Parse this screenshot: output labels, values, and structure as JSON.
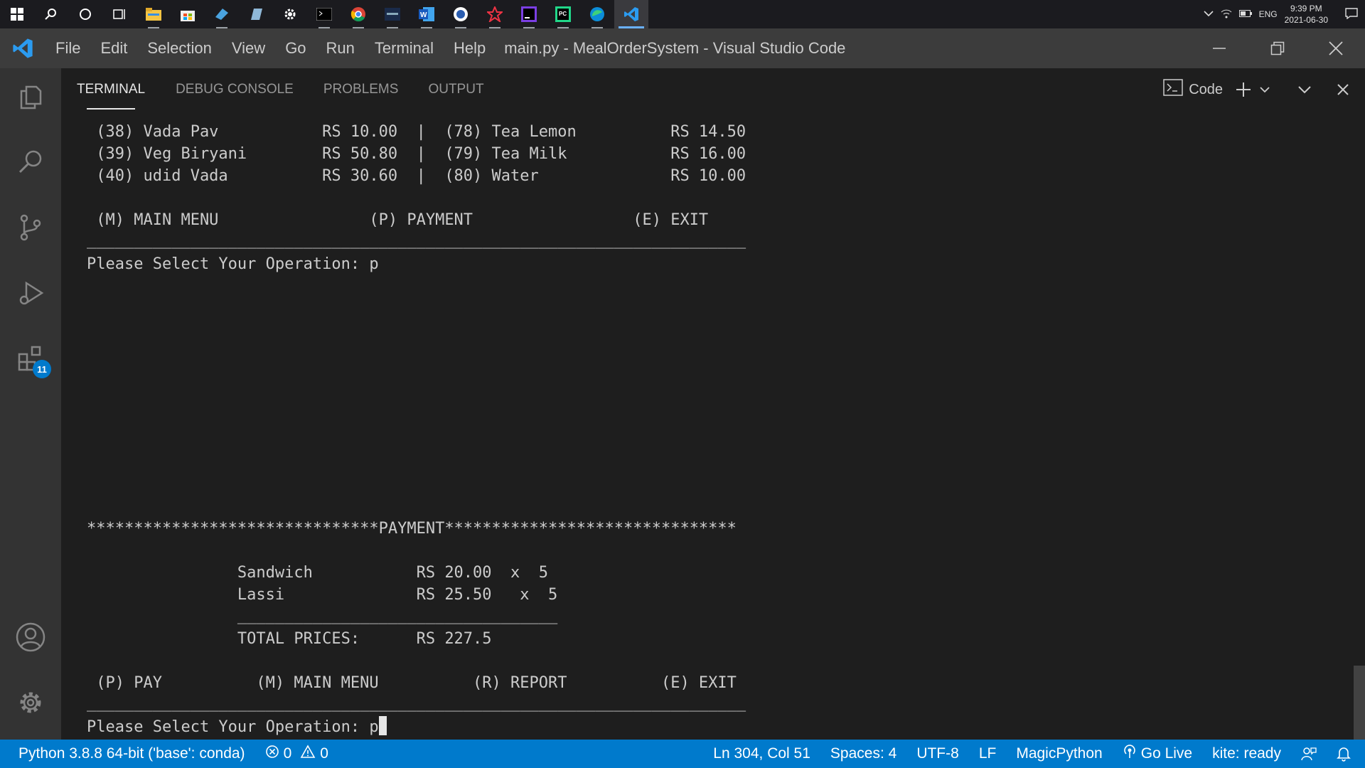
{
  "taskbar": {
    "icons": [
      "windows-start-icon",
      "search-icon",
      "cortana-icon",
      "task-view-icon",
      "file-explorer-icon",
      "store-icon",
      "app-icon",
      "app-icon",
      "settings-gear-icon",
      "terminal-icon",
      "chrome-icon",
      "app-icon",
      "word-icon",
      "app-icon",
      "app-icon",
      "jetbrains-icon",
      "pycharm-icon",
      "edge-icon",
      "vscode-icon"
    ],
    "language": "ENG",
    "time": "9:39 PM",
    "date": "2021-06-30"
  },
  "titlebar": {
    "menu": [
      "File",
      "Edit",
      "Selection",
      "View",
      "Go",
      "Run",
      "Terminal",
      "Help"
    ],
    "title": "main.py - MealOrderSystem - Visual Studio Code"
  },
  "activitybar": {
    "extensions_badge": "11"
  },
  "panel": {
    "tabs": [
      "TERMINAL",
      "DEBUG CONSOLE",
      "PROBLEMS",
      "OUTPUT"
    ],
    "active_tab": "TERMINAL",
    "terminal_name": "Code"
  },
  "terminal": {
    "lines": [
      " (38) Vada Pav           RS 10.00  |  (78) Tea Lemon          RS 14.50",
      " (39) Veg Biryani        RS 50.80  |  (79) Tea Milk           RS 16.00",
      " (40) udid Vada          RS 30.60  |  (80) Water              RS 10.00",
      " (M) MAIN MENU                (P) PAYMENT                 (E) EXIT",
      "______________________________________________________________________",
      "Please Select Your Operation: p",
      "*******************************PAYMENT*******************************",
      "                Sandwich           RS 20.00  x  5",
      "                Lassi              RS 25.50   x  5",
      "                __________________________________",
      "                TOTAL PRICES:      RS 227.5",
      " (P) PAY          (M) MAIN MENU          (R) REPORT          (E) EXIT",
      "______________________________________________________________________",
      "Please Select Your Operation: p"
    ]
  },
  "statusbar": {
    "interpreter": "Python 3.8.8 64-bit ('base': conda)",
    "errors": "0",
    "warnings": "0",
    "position": "Ln 304, Col 51",
    "spaces": "Spaces: 4",
    "encoding": "UTF-8",
    "eol": "LF",
    "language": "MagicPython",
    "golive": "Go Live",
    "kite": "kite: ready"
  },
  "colors": {
    "accent": "#007acc",
    "titlebar": "#3c3c3c",
    "activitybar": "#333333",
    "terminal_bg": "#1e1e1e"
  }
}
